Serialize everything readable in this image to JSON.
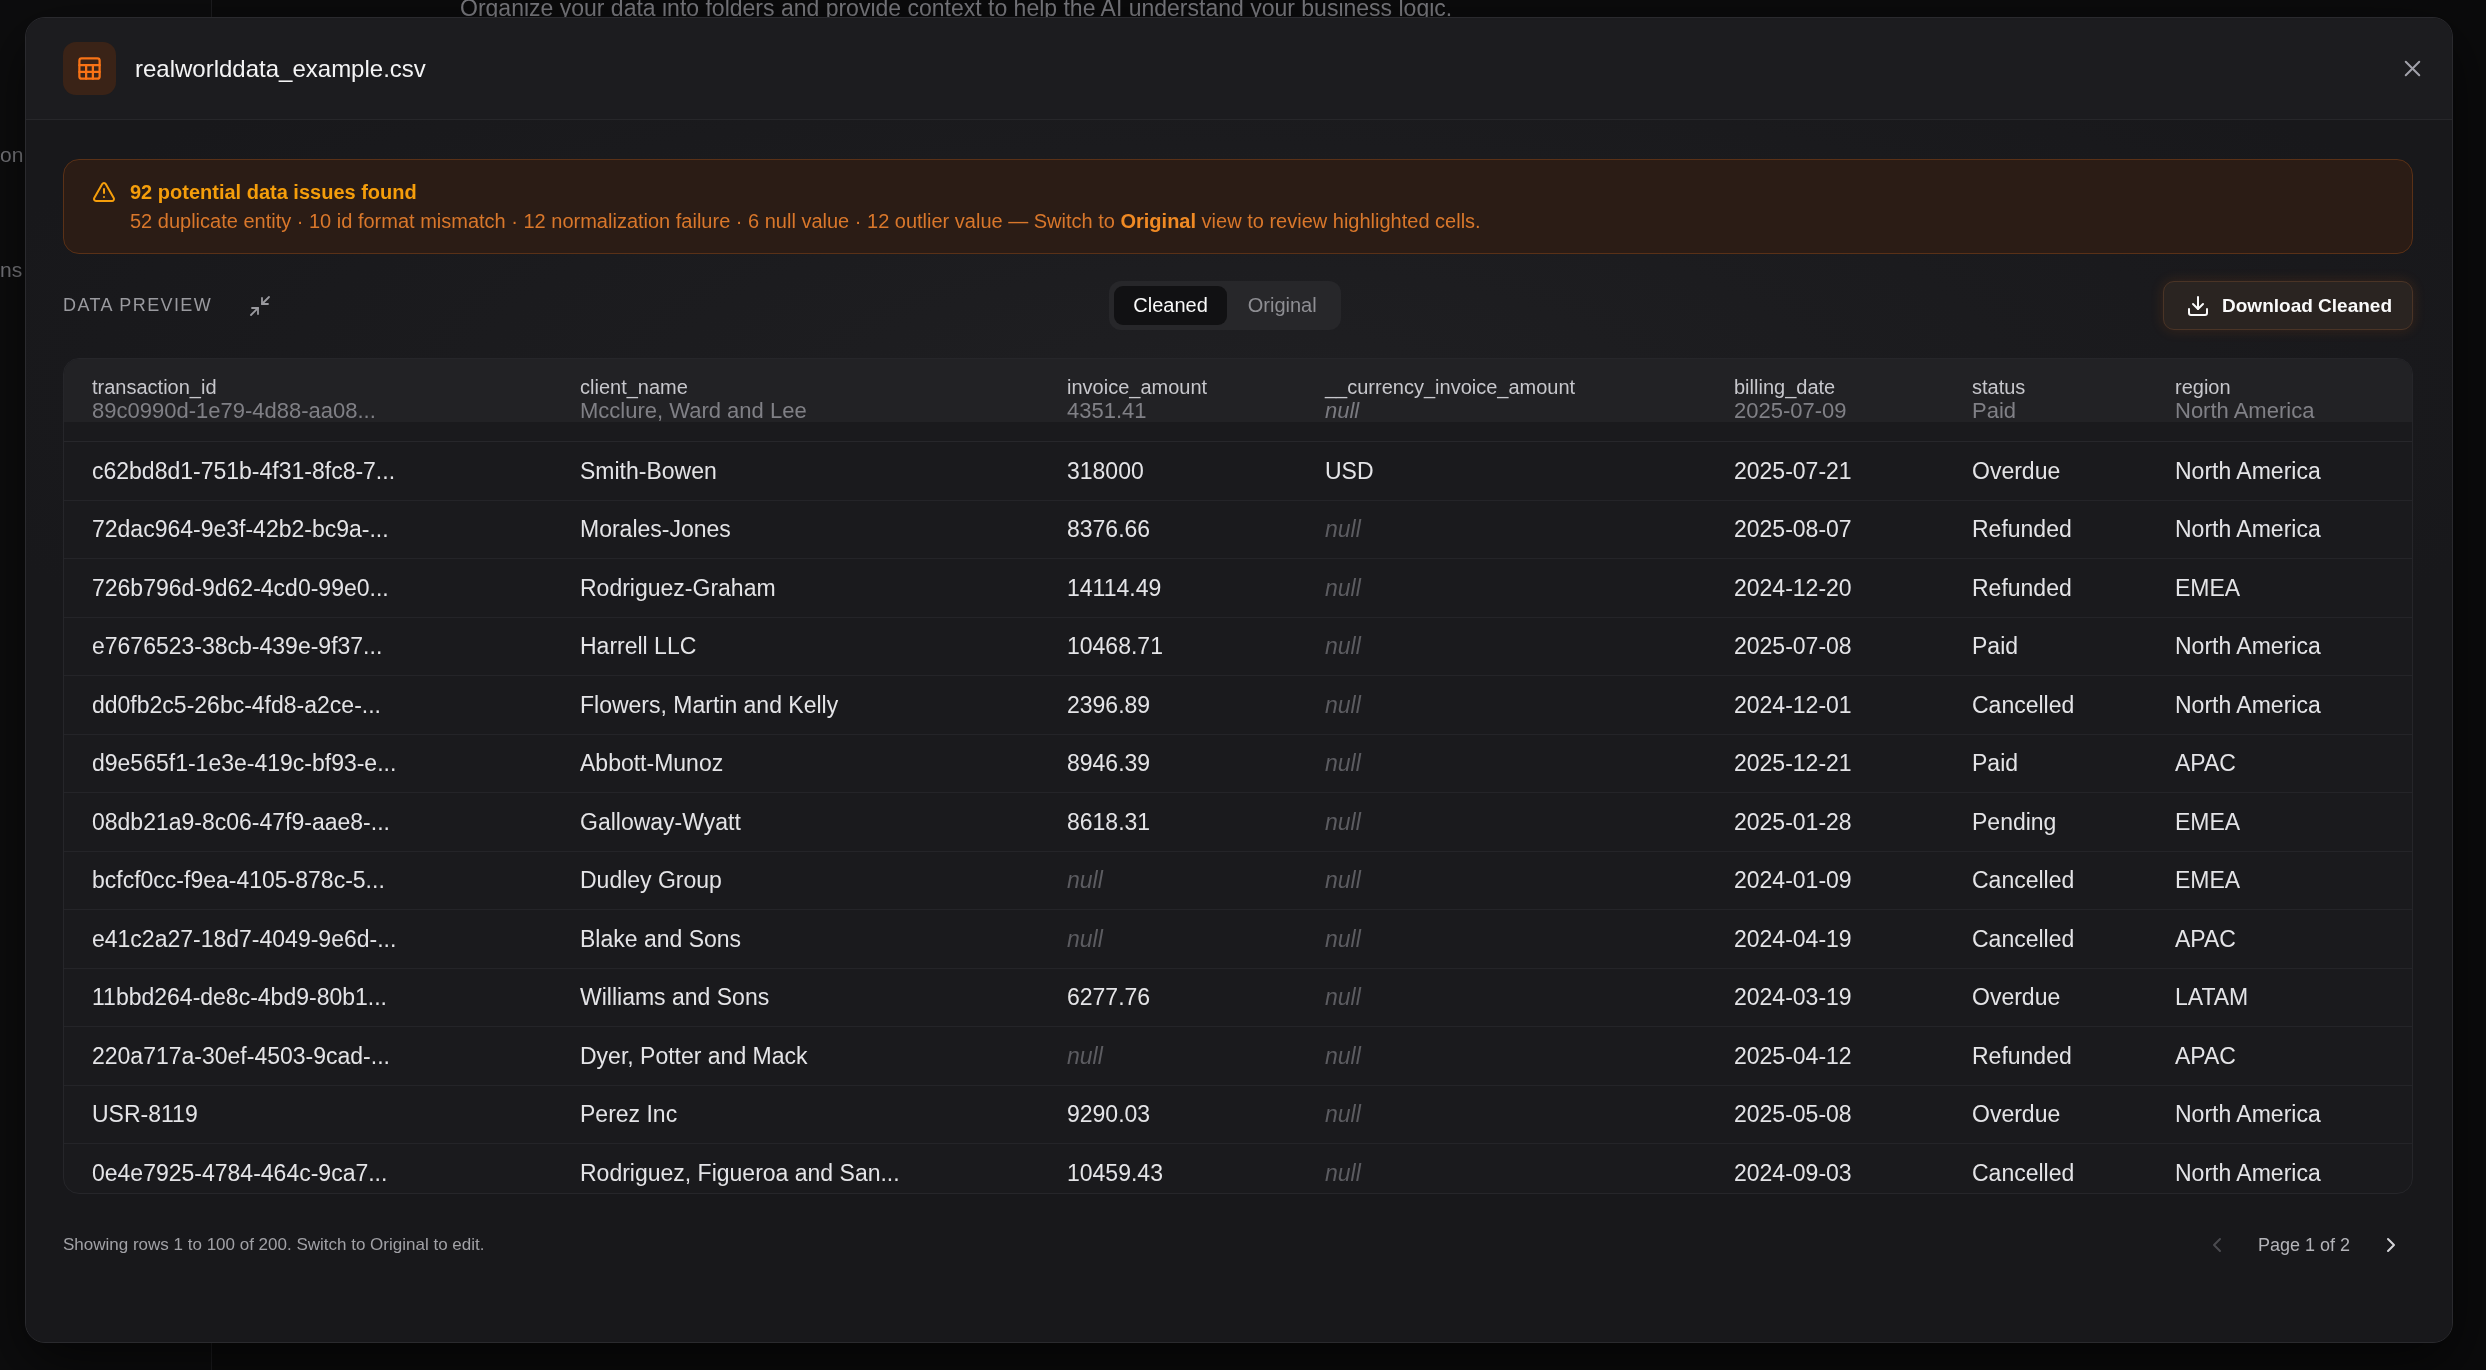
{
  "background": {
    "sidebar_items": [
      "on",
      "ns"
    ],
    "page_subtitle": "Organize your data into folders and provide context to help the AI understand your business logic."
  },
  "dialog": {
    "title": "realworlddata_example.csv"
  },
  "alert": {
    "title": "92 potential data issues found",
    "detail": "52 duplicate entity · 10 id format mismatch · 12 normalization failure · 6 null value · 12 outlier value — Switch to **Original** view to review highlighted cells."
  },
  "toolbar": {
    "section_label": "DATA PREVIEW",
    "view_tabs": [
      {
        "label": "Cleaned",
        "selected": true
      },
      {
        "label": "Original",
        "selected": false
      }
    ],
    "download_button": "Download Cleaned"
  },
  "table": {
    "columns": [
      "transaction_id",
      "client_name",
      "invoice_amount",
      "__currency_invoice_amount",
      "billing_date",
      "status",
      "region"
    ],
    "partially_hidden_row": [
      {
        "text": "89c0990d-1e79-4d88-aa08...",
        "missing": false
      },
      {
        "text": "Mcclure, Ward and Lee",
        "missing": false
      },
      {
        "text": "4351.41",
        "missing": false
      },
      {
        "text": "null",
        "missing": true
      },
      {
        "text": "2025-07-09",
        "missing": false
      },
      {
        "text": "Paid",
        "missing": false
      },
      {
        "text": "North America",
        "missing": false
      }
    ],
    "rows": [
      {
        "cells": [
          {
            "text": "c62bd8d1-751b-4f31-8fc8-7...",
            "missing": false
          },
          {
            "text": "Smith-Bowen",
            "missing": false
          },
          {
            "text": "318000",
            "missing": false
          },
          {
            "text": "USD",
            "missing": false
          },
          {
            "text": "2025-07-21",
            "missing": false
          },
          {
            "text": "Overdue",
            "missing": false
          },
          {
            "text": "North America",
            "missing": false
          }
        ]
      },
      {
        "cells": [
          {
            "text": "72dac964-9e3f-42b2-bc9a-...",
            "missing": false
          },
          {
            "text": "Morales-Jones",
            "missing": false
          },
          {
            "text": "8376.66",
            "missing": false
          },
          {
            "text": "null",
            "missing": true
          },
          {
            "text": "2025-08-07",
            "missing": false
          },
          {
            "text": "Refunded",
            "missing": false
          },
          {
            "text": "North America",
            "missing": false
          }
        ]
      },
      {
        "cells": [
          {
            "text": "726b796d-9d62-4cd0-99e0...",
            "missing": false
          },
          {
            "text": "Rodriguez-Graham",
            "missing": false
          },
          {
            "text": "14114.49",
            "missing": false
          },
          {
            "text": "null",
            "missing": true
          },
          {
            "text": "2024-12-20",
            "missing": false
          },
          {
            "text": "Refunded",
            "missing": false
          },
          {
            "text": "EMEA",
            "missing": false
          }
        ]
      },
      {
        "cells": [
          {
            "text": "e7676523-38cb-439e-9f37...",
            "missing": false
          },
          {
            "text": "Harrell LLC",
            "missing": false
          },
          {
            "text": "10468.71",
            "missing": false
          },
          {
            "text": "null",
            "missing": true
          },
          {
            "text": "2025-07-08",
            "missing": false
          },
          {
            "text": "Paid",
            "missing": false
          },
          {
            "text": "North America",
            "missing": false
          }
        ]
      },
      {
        "cells": [
          {
            "text": "dd0fb2c5-26bc-4fd8-a2ce-...",
            "missing": false
          },
          {
            "text": "Flowers, Martin and Kelly",
            "missing": false
          },
          {
            "text": "2396.89",
            "missing": false
          },
          {
            "text": "null",
            "missing": true
          },
          {
            "text": "2024-12-01",
            "missing": false
          },
          {
            "text": "Cancelled",
            "missing": false
          },
          {
            "text": "North America",
            "missing": false
          }
        ]
      },
      {
        "cells": [
          {
            "text": "d9e565f1-1e3e-419c-bf93-e...",
            "missing": false
          },
          {
            "text": "Abbott-Munoz",
            "missing": false
          },
          {
            "text": "8946.39",
            "missing": false
          },
          {
            "text": "null",
            "missing": true
          },
          {
            "text": "2025-12-21",
            "missing": false
          },
          {
            "text": "Paid",
            "missing": false
          },
          {
            "text": "APAC",
            "missing": false
          }
        ]
      },
      {
        "cells": [
          {
            "text": "08db21a9-8c06-47f9-aae8-...",
            "missing": false
          },
          {
            "text": "Galloway-Wyatt",
            "missing": false
          },
          {
            "text": "8618.31",
            "missing": false
          },
          {
            "text": "null",
            "missing": true
          },
          {
            "text": "2025-01-28",
            "missing": false
          },
          {
            "text": "Pending",
            "missing": false
          },
          {
            "text": "EMEA",
            "missing": false
          }
        ]
      },
      {
        "cells": [
          {
            "text": "bcfcf0cc-f9ea-4105-878c-5...",
            "missing": false
          },
          {
            "text": "Dudley Group",
            "missing": false
          },
          {
            "text": "null",
            "missing": true
          },
          {
            "text": "null",
            "missing": true
          },
          {
            "text": "2024-01-09",
            "missing": false
          },
          {
            "text": "Cancelled",
            "missing": false
          },
          {
            "text": "EMEA",
            "missing": false
          }
        ]
      },
      {
        "cells": [
          {
            "text": "e41c2a27-18d7-4049-9e6d-...",
            "missing": false
          },
          {
            "text": "Blake and Sons",
            "missing": false
          },
          {
            "text": "null",
            "missing": true
          },
          {
            "text": "null",
            "missing": true
          },
          {
            "text": "2024-04-19",
            "missing": false
          },
          {
            "text": "Cancelled",
            "missing": false
          },
          {
            "text": "APAC",
            "missing": false
          }
        ]
      },
      {
        "cells": [
          {
            "text": "11bbd264-de8c-4bd9-80b1...",
            "missing": false
          },
          {
            "text": "Williams and Sons",
            "missing": false
          },
          {
            "text": "6277.76",
            "missing": false
          },
          {
            "text": "null",
            "missing": true
          },
          {
            "text": "2024-03-19",
            "missing": false
          },
          {
            "text": "Overdue",
            "missing": false
          },
          {
            "text": "LATAM",
            "missing": false
          }
        ]
      },
      {
        "cells": [
          {
            "text": "220a717a-30ef-4503-9cad-...",
            "missing": false
          },
          {
            "text": "Dyer, Potter and Mack",
            "missing": false
          },
          {
            "text": "null",
            "missing": true
          },
          {
            "text": "null",
            "missing": true
          },
          {
            "text": "2025-04-12",
            "missing": false
          },
          {
            "text": "Refunded",
            "missing": false
          },
          {
            "text": "APAC",
            "missing": false
          }
        ]
      },
      {
        "cells": [
          {
            "text": "USR-8119",
            "missing": false
          },
          {
            "text": "Perez Inc",
            "missing": false
          },
          {
            "text": "9290.03",
            "missing": false
          },
          {
            "text": "null",
            "missing": true
          },
          {
            "text": "2025-05-08",
            "missing": false
          },
          {
            "text": "Overdue",
            "missing": false
          },
          {
            "text": "North America",
            "missing": false
          }
        ]
      },
      {
        "cells": [
          {
            "text": "0e4e7925-4784-464c-9ca7...",
            "missing": false
          },
          {
            "text": "Rodriguez, Figueroa and San...",
            "missing": false
          },
          {
            "text": "10459.43",
            "missing": false
          },
          {
            "text": "null",
            "missing": true
          },
          {
            "text": "2024-09-03",
            "missing": false
          },
          {
            "text": "Cancelled",
            "missing": false
          },
          {
            "text": "North America",
            "missing": false
          }
        ]
      }
    ]
  },
  "footer": {
    "summary": "Showing rows 1 to 100 of 200. Switch to Original to edit.",
    "pagination": {
      "label": "Page 1 of 2",
      "previous_disabled": true,
      "next_disabled": false
    }
  }
}
